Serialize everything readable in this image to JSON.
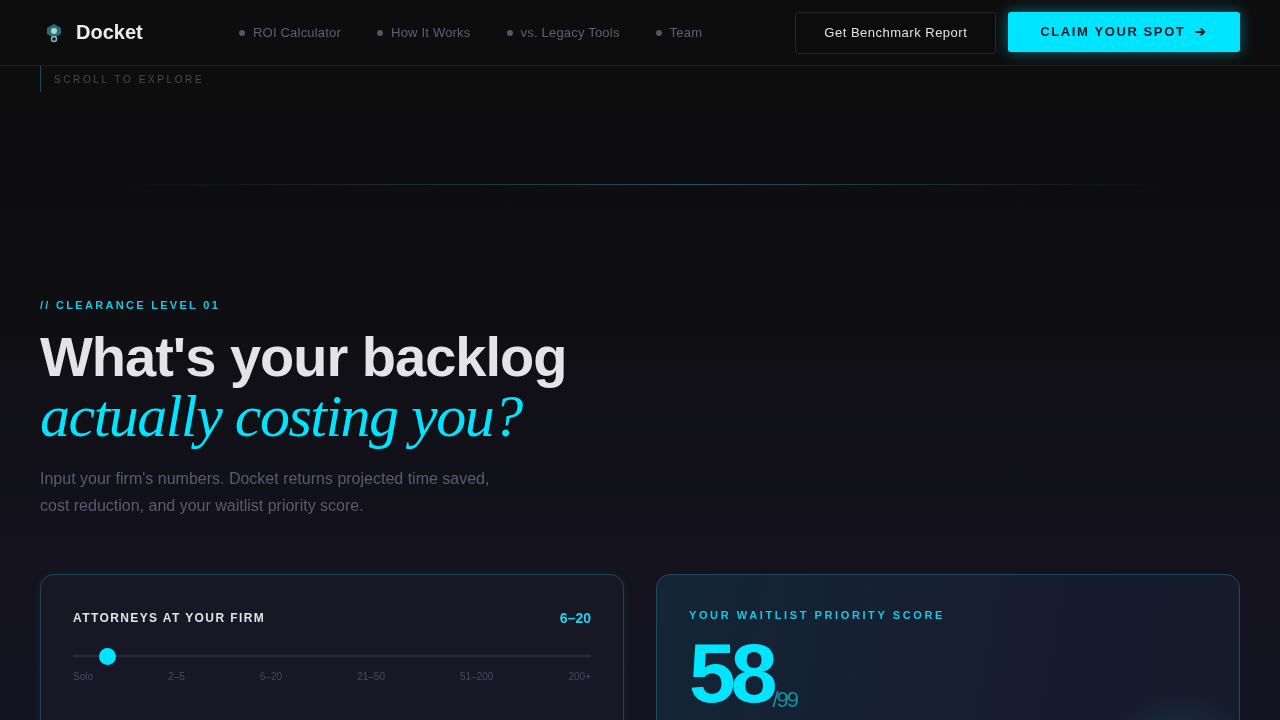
{
  "brand": {
    "name": "Docket"
  },
  "nav": [
    "ROI Calculator",
    "How It Works",
    "vs. Legacy Tools",
    "Team"
  ],
  "buttons": {
    "secondary": "Get Benchmark Report",
    "primary": "CLAIM YOUR SPOT",
    "primary_icon": "➔"
  },
  "scroll_hint": "SCROLL TO EXPLORE",
  "hero": {
    "eyebrow": "// CLEARANCE LEVEL 01",
    "title": "What's your backlog",
    "title_accent": "actually costing you?",
    "lead": "Input your firm's numbers. Docket returns projected time saved, cost reduction, and your waitlist priority score."
  },
  "calculator": {
    "label": "ATTORNEYS AT YOUR FIRM",
    "value": "6–20",
    "level": 0.05,
    "ticks": [
      "Solo",
      "2–5",
      "6–20",
      "21–50",
      "51–200",
      "200+"
    ]
  },
  "score": {
    "label": "YOUR WAITLIST PRIORITY SCORE",
    "value": "58",
    "max": "/99"
  }
}
